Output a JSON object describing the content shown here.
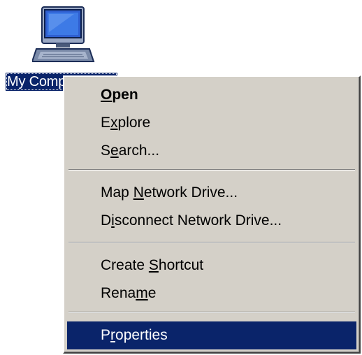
{
  "desktop": {
    "icon": {
      "name": "computer-icon",
      "label": "My Computer",
      "label_visible": "My Co"
    }
  },
  "context_menu": {
    "items": [
      {
        "label": "Open",
        "mnemonic": "O",
        "bold": true
      },
      {
        "label": "Explore",
        "mnemonic": "x"
      },
      {
        "label": "Search...",
        "mnemonic": "e"
      },
      {
        "label": "Map Network Drive...",
        "mnemonic": "N"
      },
      {
        "label": "Disconnect Network Drive...",
        "mnemonic": "i"
      },
      {
        "label": "Create Shortcut",
        "mnemonic": "S"
      },
      {
        "label": "Rename",
        "mnemonic": "m"
      },
      {
        "label": "Properties",
        "mnemonic": "r",
        "selected": true
      }
    ]
  },
  "colors": {
    "menu_background": "#d4d0c8",
    "selection_background": "#0a246a",
    "selection_text": "#ffffff"
  }
}
